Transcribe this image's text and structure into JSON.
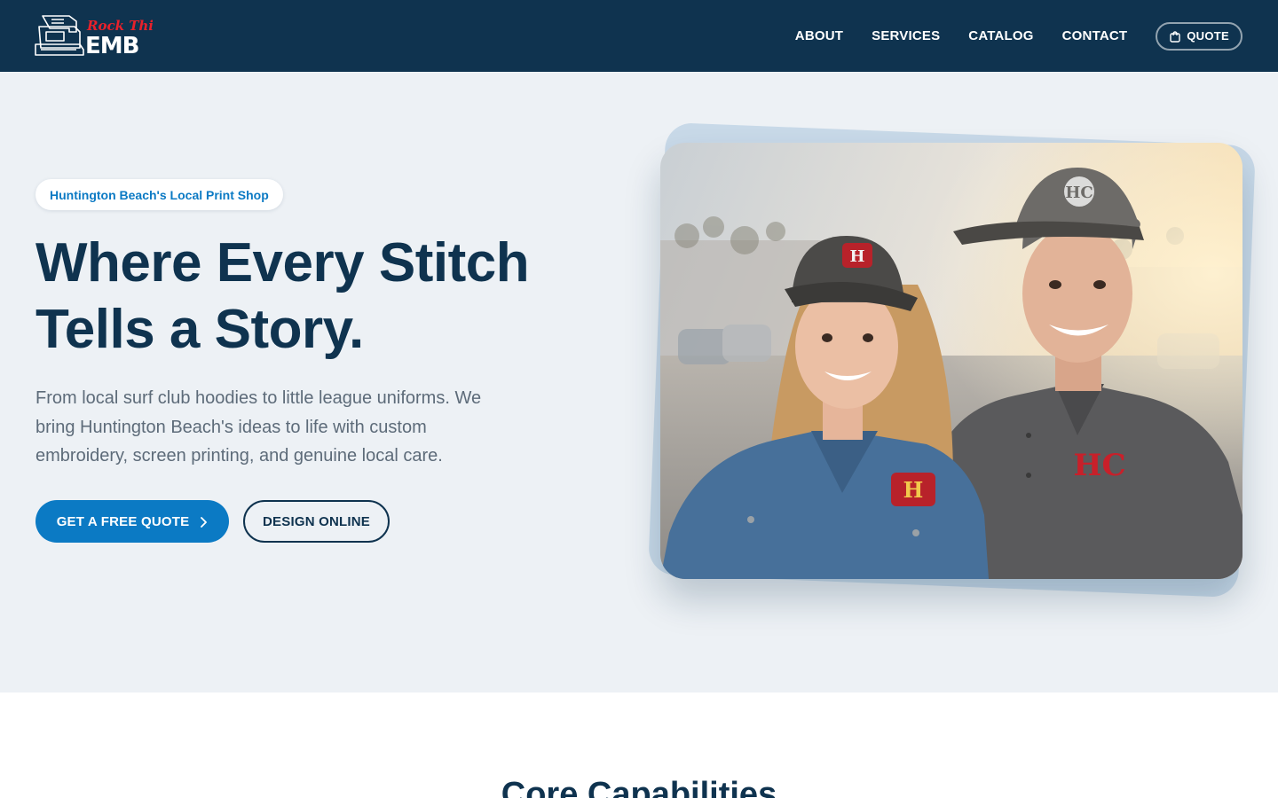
{
  "brand": {
    "logo_script": "Rock This",
    "logo_block": "EMB",
    "logo_red": "#e8212b",
    "nav_bg": "#0f334f"
  },
  "nav": {
    "links": [
      "ABOUT",
      "SERVICES",
      "CATALOG",
      "CONTACT"
    ],
    "quote_label": "QUOTE",
    "quote_icon": "shopping-bag-icon"
  },
  "hero": {
    "badge": "Huntington Beach's Local Print Shop",
    "title_line1": "Where Every Stitch",
    "title_line2": "Tells a Story.",
    "lede": "From local surf club hoodies to little league uniforms. We bring Huntington Beach's ideas to life with custom embroidery, screen printing, and genuine local care.",
    "cta_primary": "GET A FREE QUOTE",
    "cta_secondary": "DESIGN ONLINE",
    "accent": "#0b7ac4",
    "background": "#edf1f5"
  },
  "capabilities": {
    "title": "Core Capabilities"
  }
}
